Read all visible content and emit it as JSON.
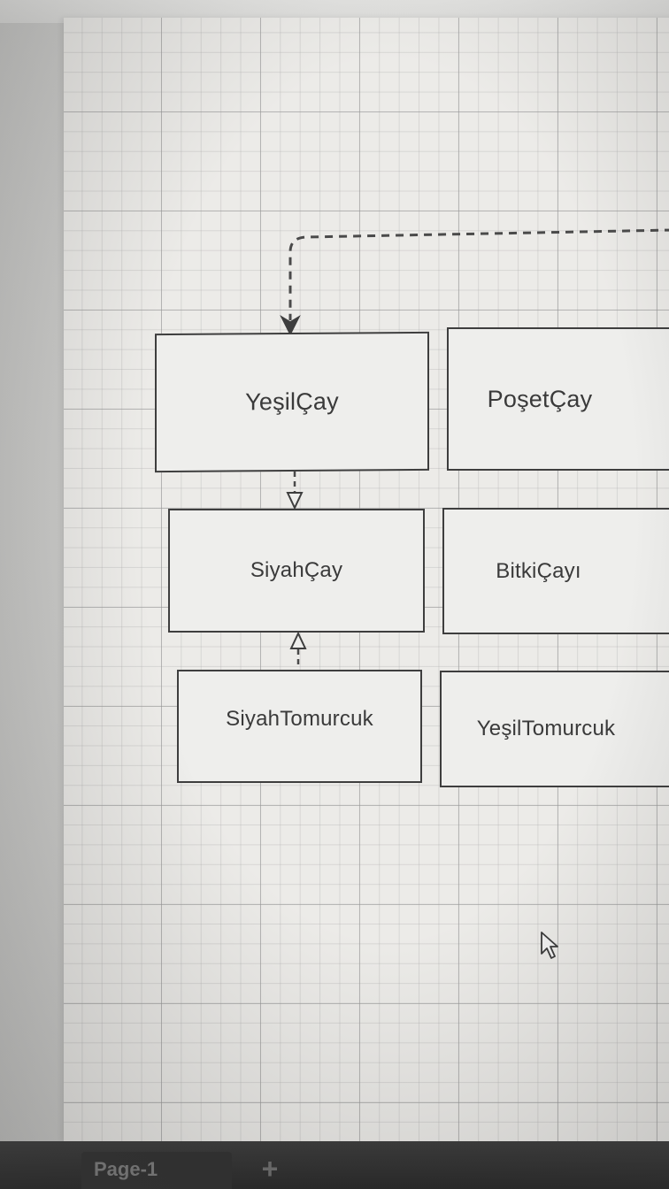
{
  "diagram": {
    "classes": {
      "yesil_cay": "YeşilÇay",
      "poset_cay": "PoşetÇay",
      "siyah_cay": "SiyahÇay",
      "bitki_cayi": "BitkiÇayı",
      "siyah_tomurcuk": "SiyahTomurcuk",
      "yesil_tomurcuk": "YeşilTomurcuk"
    }
  },
  "page_tabs": {
    "tabs": [
      "Page-1"
    ],
    "add_label": "+"
  },
  "icons": {
    "add_page": "plus-icon",
    "cursor": "mouse-pointer-icon"
  },
  "colors": {
    "canvas": "#ecebe8",
    "box_border": "#3e3e3e",
    "box_fill": "#eeeeec",
    "text": "#3a3a3a",
    "tab_bar": "#2a2a2a"
  }
}
